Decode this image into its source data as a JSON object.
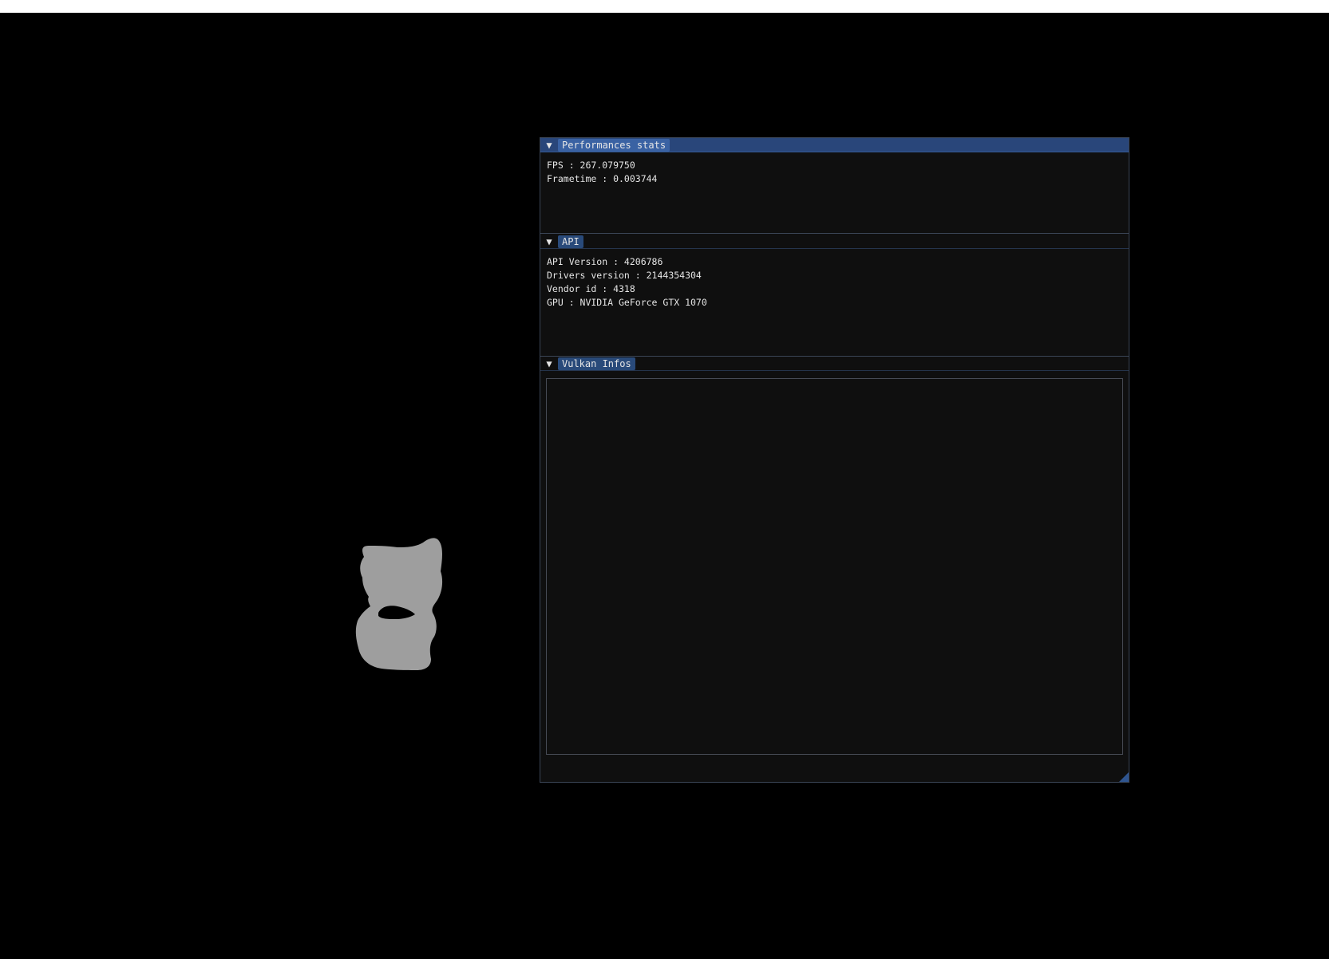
{
  "sections": [
    {
      "title": "Performances stats",
      "lines": [
        "FPS : 267.079750",
        "Frametime : 0.003744"
      ]
    },
    {
      "title": "API",
      "lines": [
        "API Version : 4206786",
        "Drivers version : 2144354304",
        "Vendor id : 4318",
        "GPU : NVIDIA GeForce GTX 1070"
      ]
    },
    {
      "title": "Vulkan Infos",
      "lines": []
    }
  ],
  "icons": {
    "collapse": "triangle-down-icon",
    "resize": "resize-grip-icon"
  },
  "colors": {
    "background": "#000000",
    "window_bg": "#0f0f0f",
    "header_active": "#29467a",
    "header_tab": "#294a7a",
    "text": "#e6e6e6",
    "model_fill": "#9e9e9e"
  }
}
